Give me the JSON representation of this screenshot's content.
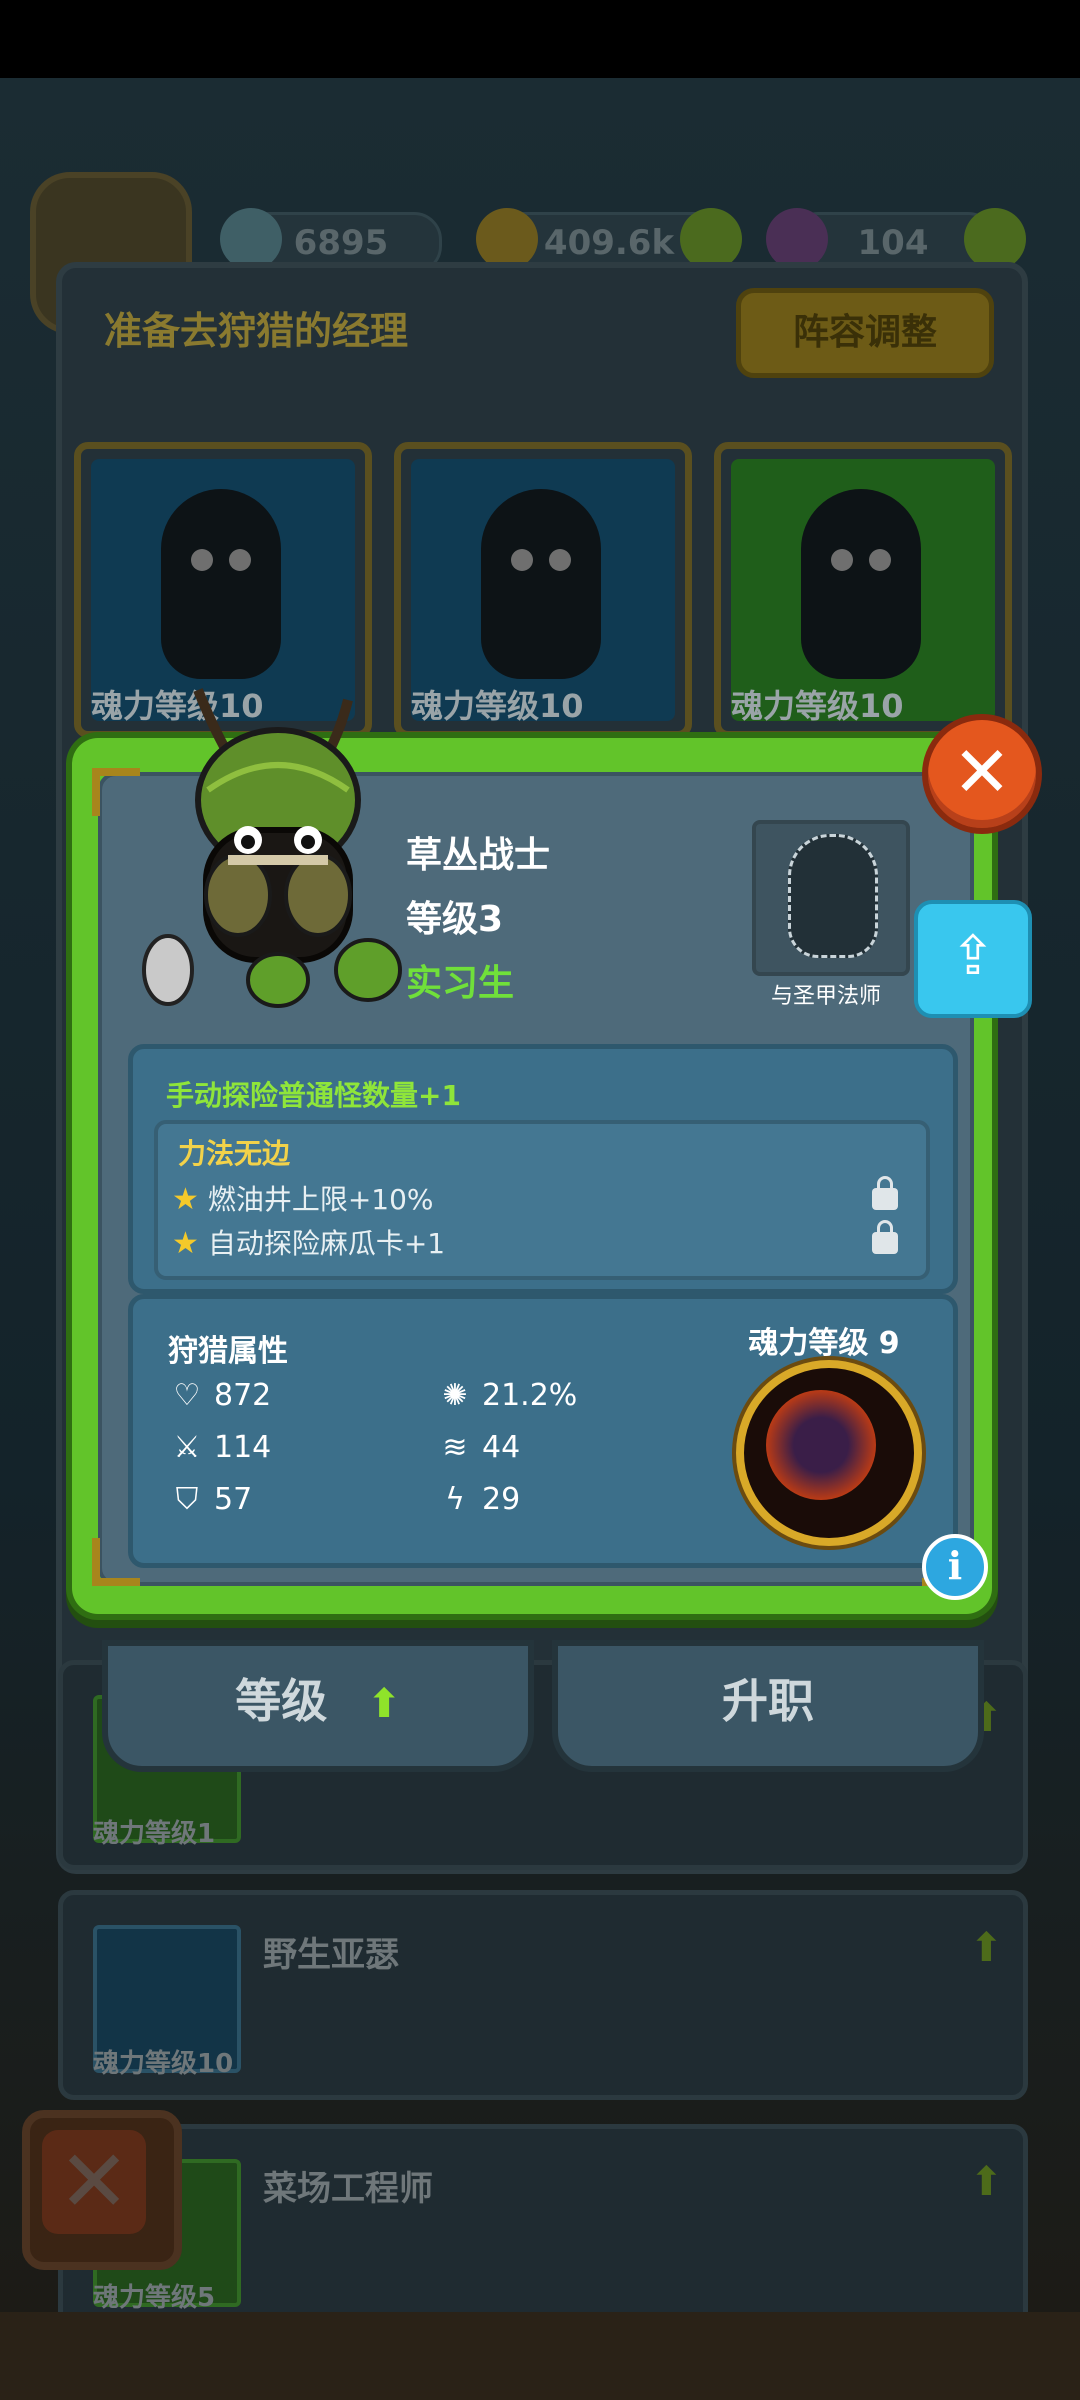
{
  "background": {
    "resources": [
      {
        "icon": "gem-icon",
        "value": "6895"
      },
      {
        "icon": "coin-icon",
        "value": "409.6k"
      },
      {
        "icon": "potion-icon",
        "value": "104"
      }
    ],
    "panel_title": "准备去狩猎的经理",
    "lineup_button": "阵容调整",
    "team_slots": [
      {
        "caption": "魂力等级10"
      },
      {
        "caption": "魂力等级10"
      },
      {
        "caption": "魂力等级10"
      }
    ],
    "list": [
      {
        "name": "",
        "caption": "魂力等级1"
      },
      {
        "name": "野生亚瑟",
        "caption": "魂力等级10"
      },
      {
        "name": "菜场工程师",
        "caption": "魂力等级5"
      }
    ]
  },
  "popup": {
    "name": "草丛战士",
    "level": "等级3",
    "rank": "实习生",
    "partner_label": "与圣甲法师",
    "bonus": "手动探险普通怪数量+1",
    "skill": {
      "title": "力法无边",
      "lines": [
        "燃油井上限+10%",
        "自动探险麻瓜卡+1"
      ]
    },
    "attributes_title": "狩猎属性",
    "attributes": [
      {
        "icon": "heart-icon",
        "value": "872"
      },
      {
        "icon": "crit-icon",
        "value": "21.2%"
      },
      {
        "icon": "sword-icon",
        "value": "114"
      },
      {
        "icon": "speed-icon",
        "value": "44"
      },
      {
        "icon": "shield-icon",
        "value": "57"
      },
      {
        "icon": "energy-icon",
        "value": "29"
      }
    ],
    "soul_level": "魂力等级 9",
    "buttons": {
      "level": "等级",
      "promote": "升职"
    }
  },
  "colors": {
    "popup_border": "#62c42a",
    "rank": "#70e03a",
    "bonus": "#8fe53a",
    "skill_title": "#f2d24a"
  }
}
